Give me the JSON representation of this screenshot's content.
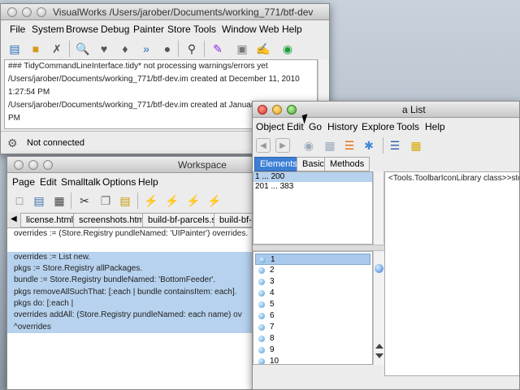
{
  "visualworks": {
    "title": "VisualWorks /Users/jarober/Documents/working_771/btf-dev",
    "menus": [
      "File",
      "System",
      "Browse",
      "Debug",
      "Painter",
      "Store",
      "Tools",
      "Window",
      "Web",
      "Help"
    ],
    "transcript": [
      "### TidyCommandLineInterface.tidy* not processing warnings/errors yet",
      "/Users/jarober/Documents/working_771/btf-dev.im created at December 11, 2010",
      "1:27:54 PM",
      "/Users/jarober/Documents/working_771/btf-dev.im created at January 1, 2011 9:10:14",
      "PM"
    ],
    "status": "Not connected"
  },
  "workspace": {
    "title": "Workspace",
    "menus": [
      "Page",
      "Edit",
      "Smalltalk",
      "Options",
      "Help"
    ],
    "tabs": [
      "license.html",
      "screenshots.html",
      "build-bf-parcels.st",
      "build-bf-p"
    ],
    "code": [
      "overrides := (Store.Registry pundleNamed: 'UIPainter') overrides.",
      "",
      "overrides := List new.",
      "pkgs := Store.Registry allPackages.",
      "bundle := Store.Registry bundleNamed: 'BottomFeeder'.",
      "pkgs removeAllSuchThat: [:each | bundle containsItem: each].",
      "pkgs  do: [:each |",
      "     overrides addAll: (Store.Registry pundleNamed: each name) ov",
      "^overrides"
    ]
  },
  "alist": {
    "title": "a List",
    "menus": [
      "Object",
      "Edit",
      "Go",
      "History",
      "Explore",
      "Tools",
      "Help"
    ],
    "tabs": [
      "Elements",
      "Basic",
      "Methods"
    ],
    "ranges": [
      "1 ... 200",
      "201 ... 383"
    ],
    "detail": "<Tools.ToolbarIconLibrary class>>stor",
    "elements": [
      "1",
      "2",
      "3",
      "4",
      "5",
      "6",
      "7",
      "8",
      "9",
      "10"
    ]
  },
  "colors": {
    "selection": "#b7d2ee",
    "listSelection": "#a9c8ec",
    "accent": "#3d7fd6"
  }
}
